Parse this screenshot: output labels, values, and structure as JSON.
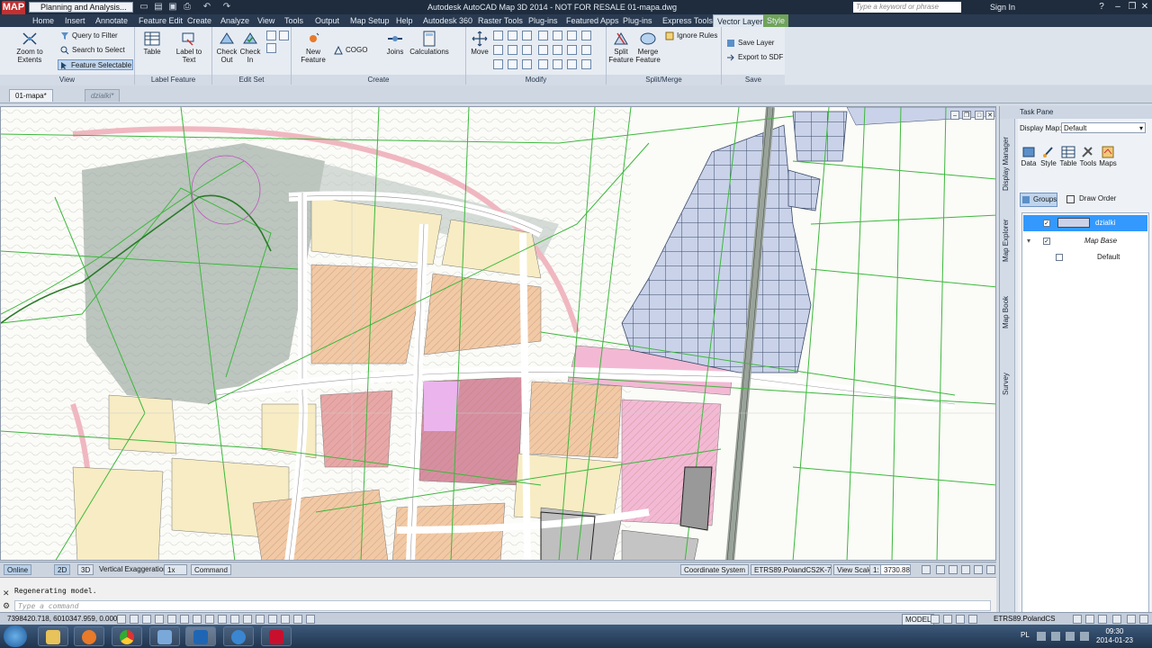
{
  "titlebar": {
    "app_logo_text": "MAP",
    "workspace": "Planning and Analysis...",
    "title": "Autodesk AutoCAD Map 3D 2014 - NOT FOR RESALE   01-mapa.dwg",
    "search_placeholder": "Type a keyword or phrase",
    "sign_in": "Sign In"
  },
  "tabs": [
    {
      "label": "Home"
    },
    {
      "label": "Insert"
    },
    {
      "label": "Annotate"
    },
    {
      "label": "Feature Edit"
    },
    {
      "label": "Create"
    },
    {
      "label": "Analyze"
    },
    {
      "label": "View"
    },
    {
      "label": "Tools"
    },
    {
      "label": "Output"
    },
    {
      "label": "Map Setup"
    },
    {
      "label": "Help"
    },
    {
      "label": "Autodesk 360"
    },
    {
      "label": "Raster Tools"
    },
    {
      "label": "Plug-ins"
    },
    {
      "label": "Featured Apps"
    },
    {
      "label": "Plug-ins"
    },
    {
      "label": "Express Tools"
    },
    {
      "label": "Vector Layer"
    },
    {
      "label": "Style"
    }
  ],
  "ribbon": {
    "view": {
      "zoom_to_extents": "Zoom to Extents",
      "query_to_filter": "Query to Filter",
      "search_to_select": "Search to Select",
      "feature_selectable": "Feature Selectable",
      "label": "View"
    },
    "label_feature": {
      "table": "Table",
      "label_to_text_1": "Label to",
      "label_to_text_2": "Text",
      "label": "Label Feature"
    },
    "edit_set": {
      "check_out_1": "Check",
      "check_out_2": "Out",
      "check_in_1": "Check",
      "check_in_2": "In",
      "label": "Edit Set"
    },
    "create": {
      "new_feature_1": "New",
      "new_feature_2": "Feature",
      "cogo": "COGO",
      "joins": "Joins",
      "calculations": "Calculations",
      "label": "Create"
    },
    "modify": {
      "move": "Move",
      "label": "Modify"
    },
    "split_merge": {
      "split_1": "Split",
      "split_2": "Feature",
      "merge_1": "Merge",
      "merge_2": "Feature",
      "ignore_rules": "Ignore Rules",
      "label": "Split/Merge"
    },
    "save": {
      "save_layer": "Save Layer",
      "export_sdf": "Export to SDF",
      "label": "Save"
    }
  },
  "doc_tabs": [
    {
      "label": "01-mapa*"
    },
    {
      "label": "dzialki*"
    }
  ],
  "task_pane": {
    "title": "Task Pane",
    "display_map_label": "Display Map:",
    "display_map_value": "Default",
    "tools": [
      {
        "label": "Data",
        "icon": "data-icon"
      },
      {
        "label": "Style",
        "icon": "style-icon"
      },
      {
        "label": "Table",
        "icon": "table-icon"
      },
      {
        "label": "Tools",
        "icon": "tools-icon"
      },
      {
        "label": "Maps",
        "icon": "maps-icon"
      }
    ],
    "groups": "Groups",
    "draw_order": "Draw Order",
    "layers": [
      {
        "name": "dzialki",
        "checked": true
      },
      {
        "name": "Map Base",
        "checked": true
      },
      {
        "name": "Default",
        "checked": false
      }
    ],
    "vtabs": [
      {
        "label": "Display Manager"
      },
      {
        "label": "Map Explorer"
      },
      {
        "label": "Map Book"
      },
      {
        "label": "Survey"
      }
    ]
  },
  "status": {
    "online": "Online",
    "mode_2d": "2D",
    "mode_3d": "3D",
    "vertical_exaggeration": "Vertical Exaggeration:",
    "ve_value": "1x",
    "command": "Command",
    "coordinate_system": "Coordinate System",
    "cs_value": "ETRS89.PolandCS2K-7",
    "view_scale": "View Scale",
    "view_scale_value": "1:",
    "scale_number": "3730.88"
  },
  "command": {
    "history": "Regenerating model.",
    "placeholder": "Type a command"
  },
  "status2": {
    "coordinates": "7398420.718, 6010347.959, 0.000",
    "model": "MODEL",
    "coord_sys": "ETRS89.PolandCS"
  },
  "taskbar": {
    "lang": "PL",
    "time": "09:30",
    "date": "2014-01-23"
  },
  "colors": {
    "parcel_blue": "#c9d2e8",
    "zone_orange": "#f1c9a4",
    "zone_yellow": "#f7ecc3",
    "zone_pink": "#f3b9d4",
    "zone_red": "#e8a7a7",
    "green_lines": "#3cb83c",
    "selection": "#3399ff"
  }
}
